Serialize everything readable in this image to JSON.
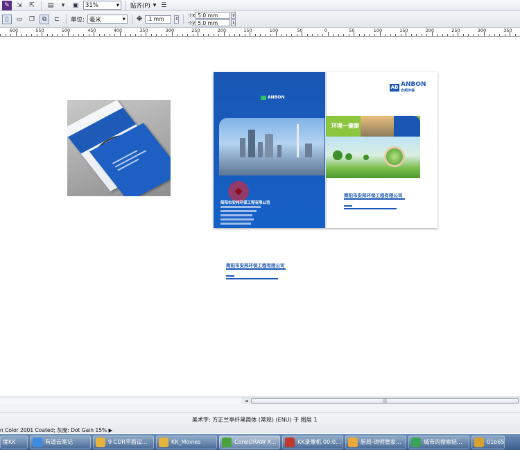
{
  "toolbar1": {
    "zoom_value": "31%",
    "snap_label": "贴齐(P)"
  },
  "toolbar2": {
    "unit_label": "单位:",
    "unit_value": "毫米",
    "nudge_value": ".1 mm",
    "dup_x_value": "5.0 mm",
    "dup_y_value": "5.0 mm"
  },
  "ruler": {
    "labels": [
      "600",
      "550",
      "500",
      "450",
      "400",
      "350",
      "300",
      "250",
      "200",
      "150",
      "100",
      "50",
      "0",
      "50",
      "100",
      "150",
      "200",
      "250",
      "300",
      "350"
    ]
  },
  "brochure": {
    "brand": "ANBON",
    "brand_sub": "安邦环保",
    "slogan": "环境一健康",
    "company_left": "简阳市安邦环保工程有限公司",
    "company_right": "简阳市安邦环保工程有限公司"
  },
  "canvas_text": {
    "company": "简阳市安邦环保工程有限公司"
  },
  "scrollbar": {
    "left_arrow": "◄",
    "grip": "|||"
  },
  "status": {
    "object_info": "美术字: 方正兰亭纤黑简体 (常规) (ENU) 于 图层 1",
    "color_profile": "n Color 2001 Coated; 灰度: Dot Gain 15%",
    "arrow": "▶"
  },
  "taskbar": {
    "items": [
      {
        "label": "度KK",
        "icon_color": "#2a6fc0"
      },
      {
        "label": "有道云笔记",
        "icon_color": "#3d8be0"
      },
      {
        "label": "9 CDR平面设...",
        "icon_color": "#e3b33b"
      },
      {
        "label": "KK_Movies",
        "icon_color": "#e3b33b"
      },
      {
        "label": "CorelDRAW X...",
        "icon_color": "#48a33a"
      },
      {
        "label": "KK录像机 00:0...",
        "icon_color": "#c0392b"
      },
      {
        "label": "厨局-讲师管家...",
        "icon_color": "#e9a83a"
      },
      {
        "label": "城市的搜索结...",
        "icon_color": "#3aa35a"
      },
      {
        "label": "01b65",
        "icon_color": "#d8a22e"
      }
    ]
  }
}
